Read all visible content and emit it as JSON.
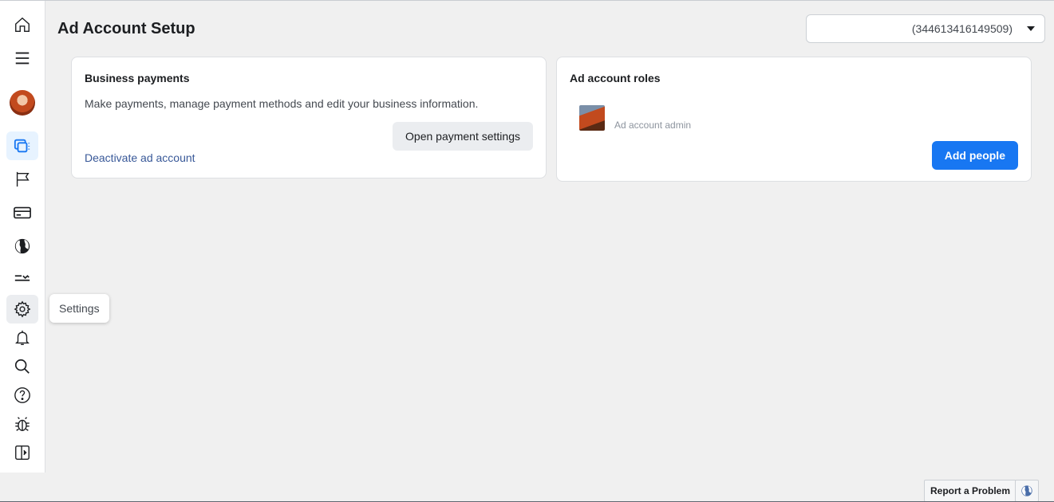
{
  "header": {
    "title": "Ad Account Setup",
    "account_selector_value": "(344613416149509)"
  },
  "rail": {
    "items": [
      {
        "name": "home",
        "icon": "home-icon"
      },
      {
        "name": "menu",
        "icon": "hamburger-menu-icon"
      },
      {
        "name": "profile",
        "icon": "avatar"
      },
      {
        "name": "ads-manager",
        "icon": "ads-manager-icon",
        "active": true
      },
      {
        "name": "pages",
        "icon": "flag-icon"
      },
      {
        "name": "billing",
        "icon": "credit-card-icon"
      },
      {
        "name": "audiences",
        "icon": "globe-icon"
      },
      {
        "name": "transactions",
        "icon": "payment-icon"
      },
      {
        "name": "settings",
        "icon": "gear-icon",
        "hovered": true
      },
      {
        "name": "notifications",
        "icon": "bell-icon"
      },
      {
        "name": "search",
        "icon": "search-icon"
      },
      {
        "name": "help",
        "icon": "help-icon"
      },
      {
        "name": "report-bug",
        "icon": "bug-icon"
      },
      {
        "name": "collapse",
        "icon": "collapse-panel-icon"
      }
    ],
    "tooltip": "Settings"
  },
  "business_payments": {
    "title": "Business payments",
    "description": "Make payments, manage payment methods and edit your business information.",
    "open_settings_label": "Open payment settings",
    "deactivate_label": "Deactivate ad account"
  },
  "ad_account_roles": {
    "title": "Ad account roles",
    "role_label": "Ad account admin",
    "add_people_label": "Add people"
  },
  "footer": {
    "report_label": "Report a Problem",
    "globe_icon": "globe-icon"
  },
  "colors": {
    "accent": "#1877f2",
    "link": "#385898",
    "background": "#f0f0f0"
  }
}
